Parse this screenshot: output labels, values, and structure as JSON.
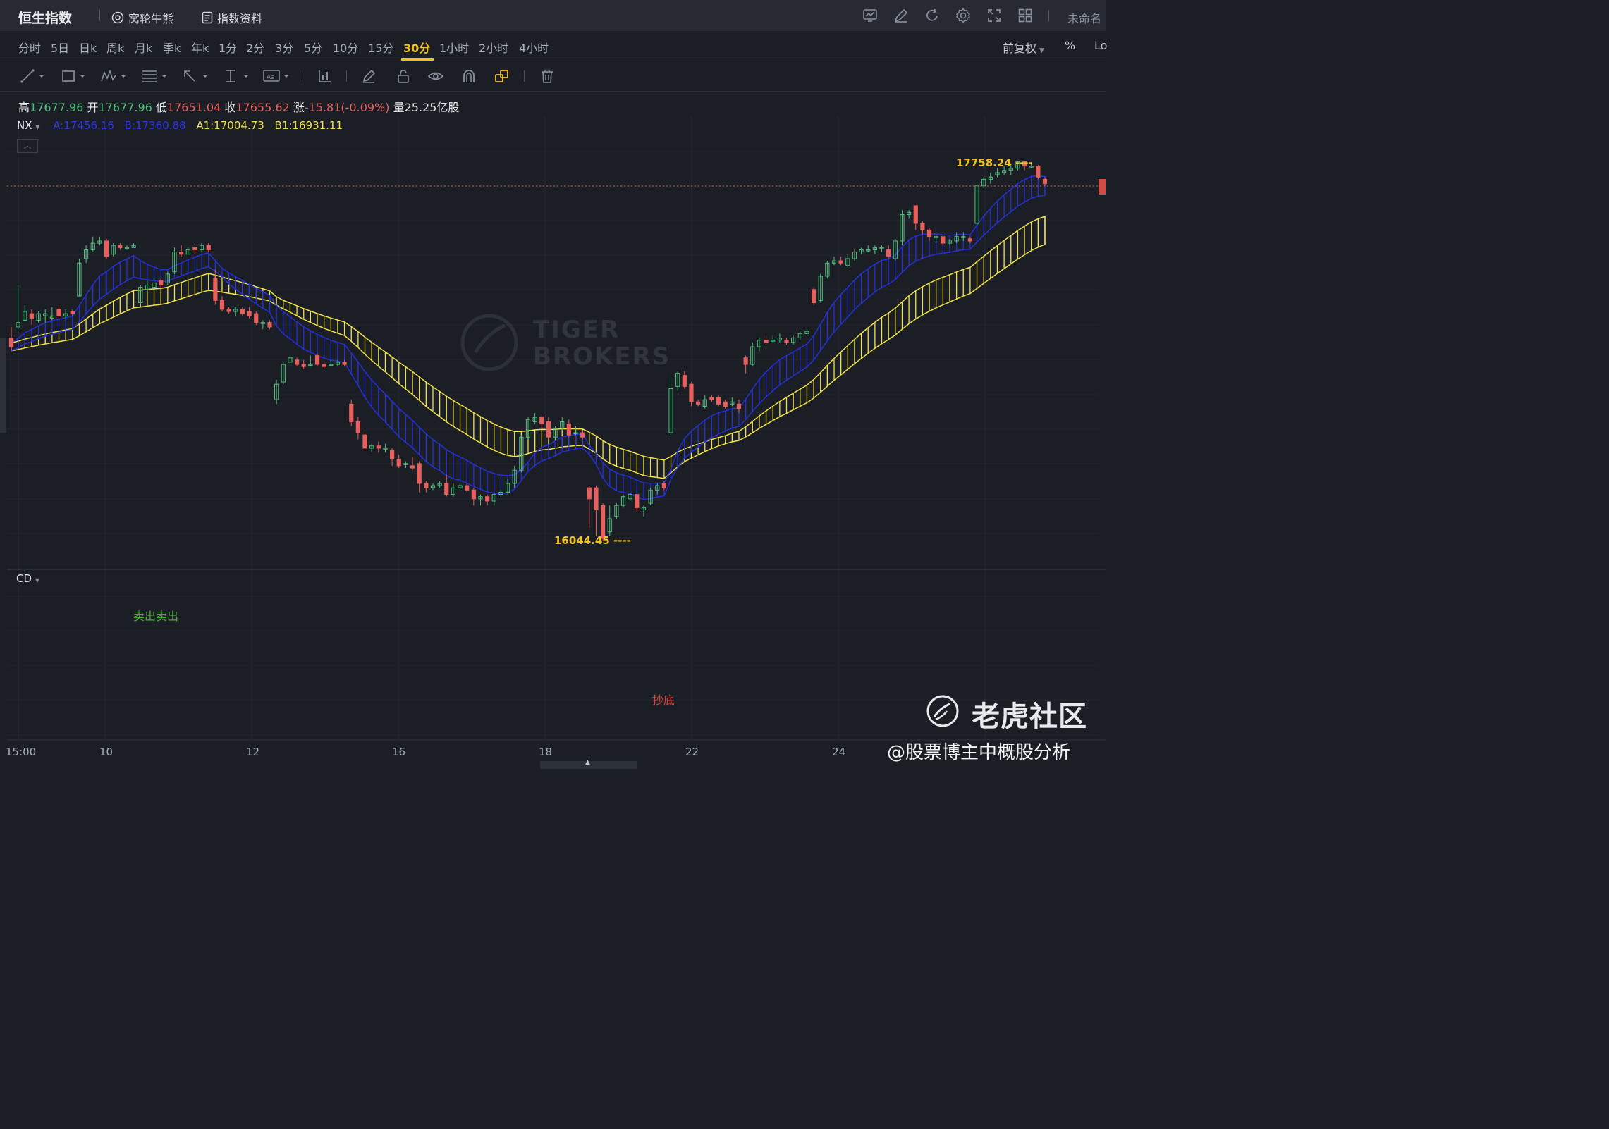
{
  "app": {
    "title": "恒生指数",
    "links": [
      {
        "label": "窝轮牛熊",
        "icon": "warrant-icon"
      },
      {
        "label": "指数资料",
        "icon": "document-icon"
      }
    ],
    "doc_name": "未命名"
  },
  "periods": [
    "分时",
    "5日",
    "日k",
    "周k",
    "月k",
    "季k",
    "年k",
    "1分",
    "2分",
    "3分",
    "5分",
    "10分",
    "15分",
    "30分",
    "1小时",
    "2小时",
    "4小时"
  ],
  "active_period": "30分",
  "right_options": {
    "adjust": "前复权",
    "percent": "%",
    "log": "Lo"
  },
  "ohlc": {
    "high_label": "高",
    "high": "17677.96",
    "open_label": "开",
    "open": "17677.96",
    "low_label": "低",
    "low": "17651.04",
    "close_label": "收",
    "close": "17655.62",
    "change_label": "涨",
    "change": "-15.81(-0.09%)",
    "volume_label": "量",
    "volume": "25.25亿股"
  },
  "indicator": {
    "name": "NX",
    "a": "A:17456.16",
    "b": "B:17360.88",
    "a1": "A1:17004.73",
    "b1": "B1:16931.11"
  },
  "annotations": {
    "max_label": "17758.24 ----",
    "min_label": "16044.45 ----"
  },
  "sub_indicator": {
    "name": "CD",
    "sell_label": "卖出卖出",
    "bottom_label": "抄底"
  },
  "x_axis": [
    "15:00",
    "10",
    "12",
    "16",
    "18",
    "22",
    "24"
  ],
  "watermark": {
    "brand": "老虎社区",
    "author": "@股票博主中概股分析",
    "tiger": "TIGER BROKERS"
  },
  "colors": {
    "up": "#4fbf7d",
    "down": "#e8605d",
    "band_blue": "#2430d8",
    "band_yellow": "#f0e24a",
    "accent": "#f4c21c",
    "bg": "#1b1e25"
  },
  "chart_data": {
    "type": "candlestick",
    "title": "恒生指数 30分",
    "ylim": [
      15900,
      17900
    ],
    "series_candles": [
      [
        16960,
        16920,
        17010,
        16900
      ],
      [
        17010,
        17030,
        17200,
        17000
      ],
      [
        17040,
        17080,
        17110,
        17040
      ],
      [
        17070,
        17050,
        17090,
        17020
      ],
      [
        17040,
        17070,
        17080,
        17030
      ],
      [
        17060,
        17070,
        17090,
        17030
      ],
      [
        17050,
        17060,
        17100,
        17040
      ],
      [
        17090,
        17060,
        17110,
        17050
      ],
      [
        17060,
        17070,
        17090,
        17050
      ],
      [
        17080,
        17070,
        17090,
        17060
      ],
      [
        17150,
        17300,
        17320,
        17150
      ],
      [
        17320,
        17360,
        17380,
        17300
      ],
      [
        17360,
        17390,
        17420,
        17350
      ],
      [
        17390,
        17400,
        17420,
        17380
      ],
      [
        17400,
        17330,
        17410,
        17320
      ],
      [
        17340,
        17380,
        17390,
        17330
      ],
      [
        17380,
        17370,
        17390,
        17360
      ],
      [
        17370,
        17370,
        17380,
        17360
      ],
      [
        17370,
        17380,
        17390,
        17370
      ],
      [
        17120,
        17190,
        17200,
        17110
      ],
      [
        17180,
        17200,
        17220,
        17170
      ],
      [
        17190,
        17210,
        17230,
        17180
      ],
      [
        17220,
        17200,
        17230,
        17180
      ],
      [
        17210,
        17250,
        17260,
        17200
      ],
      [
        17260,
        17350,
        17370,
        17250
      ],
      [
        17350,
        17340,
        17380,
        17330
      ],
      [
        17340,
        17360,
        17370,
        17340
      ],
      [
        17370,
        17360,
        17380,
        17340
      ],
      [
        17360,
        17380,
        17390,
        17350
      ],
      [
        17380,
        17360,
        17390,
        17350
      ],
      [
        17230,
        17130,
        17270,
        17110
      ],
      [
        17130,
        17090,
        17150,
        17080
      ],
      [
        17090,
        17080,
        17100,
        17070
      ],
      [
        17080,
        17090,
        17100,
        17060
      ],
      [
        17090,
        17070,
        17100,
        17060
      ],
      [
        17080,
        17060,
        17100,
        17050
      ],
      [
        17070,
        17030,
        17080,
        17020
      ],
      [
        17030,
        17030,
        17040,
        17000
      ],
      [
        17030,
        17010,
        17040,
        17000
      ],
      [
        16680,
        16750,
        16770,
        16660
      ],
      [
        16760,
        16840,
        16850,
        16750
      ],
      [
        16850,
        16870,
        16880,
        16840
      ],
      [
        16860,
        16840,
        16870,
        16830
      ],
      [
        16840,
        16830,
        16860,
        16820
      ],
      [
        16840,
        16840,
        16880,
        16830
      ],
      [
        16880,
        16840,
        16890,
        16830
      ],
      [
        16840,
        16830,
        16850,
        16820
      ],
      [
        16840,
        16840,
        16860,
        16830
      ],
      [
        16840,
        16850,
        16860,
        16830
      ],
      [
        16850,
        16840,
        16860,
        16830
      ],
      [
        16660,
        16580,
        16680,
        16560
      ],
      [
        16580,
        16530,
        16600,
        16500
      ],
      [
        16520,
        16460,
        16530,
        16450
      ],
      [
        16460,
        16470,
        16480,
        16440
      ],
      [
        16470,
        16460,
        16490,
        16440
      ],
      [
        16460,
        16460,
        16480,
        16440
      ],
      [
        16450,
        16410,
        16460,
        16380
      ],
      [
        16410,
        16380,
        16430,
        16370
      ],
      [
        16390,
        16390,
        16400,
        16370
      ],
      [
        16380,
        16370,
        16420,
        16360
      ],
      [
        16390,
        16300,
        16400,
        16260
      ],
      [
        16300,
        16280,
        16310,
        16260
      ],
      [
        16280,
        16290,
        16300,
        16270
      ],
      [
        16290,
        16300,
        16310,
        16280
      ],
      [
        16300,
        16250,
        16340,
        16240
      ],
      [
        16250,
        16280,
        16300,
        16240
      ],
      [
        16280,
        16290,
        16310,
        16270
      ],
      [
        16290,
        16270,
        16300,
        16260
      ],
      [
        16270,
        16230,
        16280,
        16200
      ],
      [
        16230,
        16240,
        16250,
        16200
      ],
      [
        16240,
        16220,
        16250,
        16200
      ],
      [
        16220,
        16250,
        16260,
        16200
      ],
      [
        16250,
        16260,
        16270,
        16240
      ],
      [
        16260,
        16300,
        16320,
        16250
      ],
      [
        16300,
        16360,
        16380,
        16280
      ],
      [
        16360,
        16510,
        16520,
        16350
      ],
      [
        16510,
        16590,
        16600,
        16500
      ],
      [
        16580,
        16600,
        16620,
        16570
      ],
      [
        16600,
        16570,
        16610,
        16550
      ],
      [
        16580,
        16510,
        16600,
        16500
      ],
      [
        16510,
        16550,
        16560,
        16500
      ],
      [
        16550,
        16580,
        16600,
        16540
      ],
      [
        16570,
        16520,
        16590,
        16510
      ],
      [
        16530,
        16530,
        16560,
        16520
      ],
      [
        16530,
        16510,
        16540,
        16500
      ],
      [
        16280,
        16230,
        16290,
        16100
      ],
      [
        16280,
        16180,
        16290,
        16060
      ],
      [
        16200,
        16050,
        16210,
        16040
      ],
      [
        16080,
        16140,
        16200,
        16060
      ],
      [
        16150,
        16200,
        16210,
        16140
      ],
      [
        16200,
        16240,
        16250,
        16190
      ],
      [
        16230,
        16250,
        16260,
        16220
      ],
      [
        16250,
        16190,
        16250,
        16170
      ],
      [
        16180,
        16190,
        16200,
        16150
      ],
      [
        16210,
        16270,
        16280,
        16200
      ],
      [
        16270,
        16290,
        16300,
        16250
      ],
      [
        16300,
        16280,
        16310,
        16270
      ],
      [
        16530,
        16730,
        16780,
        16520
      ],
      [
        16740,
        16800,
        16810,
        16720
      ],
      [
        16790,
        16740,
        16810,
        16730
      ],
      [
        16750,
        16670,
        16760,
        16650
      ],
      [
        16670,
        16660,
        16680,
        16650
      ],
      [
        16650,
        16680,
        16700,
        16640
      ],
      [
        16690,
        16680,
        16700,
        16670
      ],
      [
        16690,
        16660,
        16700,
        16650
      ],
      [
        16670,
        16650,
        16680,
        16640
      ],
      [
        16660,
        16670,
        16690,
        16650
      ],
      [
        16660,
        16640,
        16680,
        16620
      ],
      [
        16870,
        16840,
        16880,
        16800
      ],
      [
        16840,
        16920,
        16940,
        16830
      ],
      [
        16920,
        16950,
        16960,
        16900
      ],
      [
        16950,
        16940,
        16970,
        16930
      ],
      [
        16950,
        16950,
        16970,
        16940
      ],
      [
        16950,
        16960,
        16980,
        16940
      ],
      [
        16950,
        16940,
        16960,
        16930
      ],
      [
        16940,
        16960,
        16970,
        16930
      ],
      [
        16960,
        16980,
        16990,
        16950
      ],
      [
        16980,
        16990,
        17000,
        16970
      ],
      [
        17180,
        17120,
        17190,
        17110
      ],
      [
        17130,
        17240,
        17250,
        17120
      ],
      [
        17240,
        17300,
        17310,
        17230
      ],
      [
        17300,
        17310,
        17330,
        17290
      ],
      [
        17310,
        17300,
        17330,
        17290
      ],
      [
        17290,
        17320,
        17340,
        17280
      ],
      [
        17320,
        17350,
        17360,
        17310
      ],
      [
        17350,
        17360,
        17370,
        17340
      ],
      [
        17360,
        17360,
        17380,
        17350
      ],
      [
        17360,
        17370,
        17380,
        17340
      ],
      [
        17370,
        17370,
        17380,
        17350
      ],
      [
        17360,
        17330,
        17380,
        17320
      ],
      [
        17320,
        17400,
        17410,
        17310
      ],
      [
        17400,
        17520,
        17540,
        17380
      ],
      [
        17520,
        17530,
        17540,
        17500
      ],
      [
        17560,
        17480,
        17560,
        17450
      ],
      [
        17480,
        17450,
        17490,
        17430
      ],
      [
        17450,
        17420,
        17460,
        17400
      ],
      [
        17420,
        17420,
        17430,
        17390
      ],
      [
        17420,
        17390,
        17430,
        17380
      ],
      [
        17390,
        17400,
        17410,
        17380
      ],
      [
        17400,
        17420,
        17440,
        17390
      ],
      [
        17420,
        17420,
        17440,
        17400
      ],
      [
        17410,
        17400,
        17420,
        17390
      ],
      [
        17480,
        17650,
        17660,
        17470
      ],
      [
        17650,
        17680,
        17690,
        17640
      ],
      [
        17680,
        17690,
        17710,
        17660
      ],
      [
        17700,
        17710,
        17730,
        17690
      ],
      [
        17710,
        17720,
        17740,
        17700
      ],
      [
        17720,
        17730,
        17750,
        17700
      ],
      [
        17730,
        17760,
        17760,
        17720
      ],
      [
        17760,
        17740,
        17758,
        17720
      ],
      [
        17740,
        17740,
        17758,
        17730
      ],
      [
        17740,
        17690,
        17745,
        17680
      ],
      [
        17680,
        17660,
        17690,
        17650
      ]
    ]
  }
}
